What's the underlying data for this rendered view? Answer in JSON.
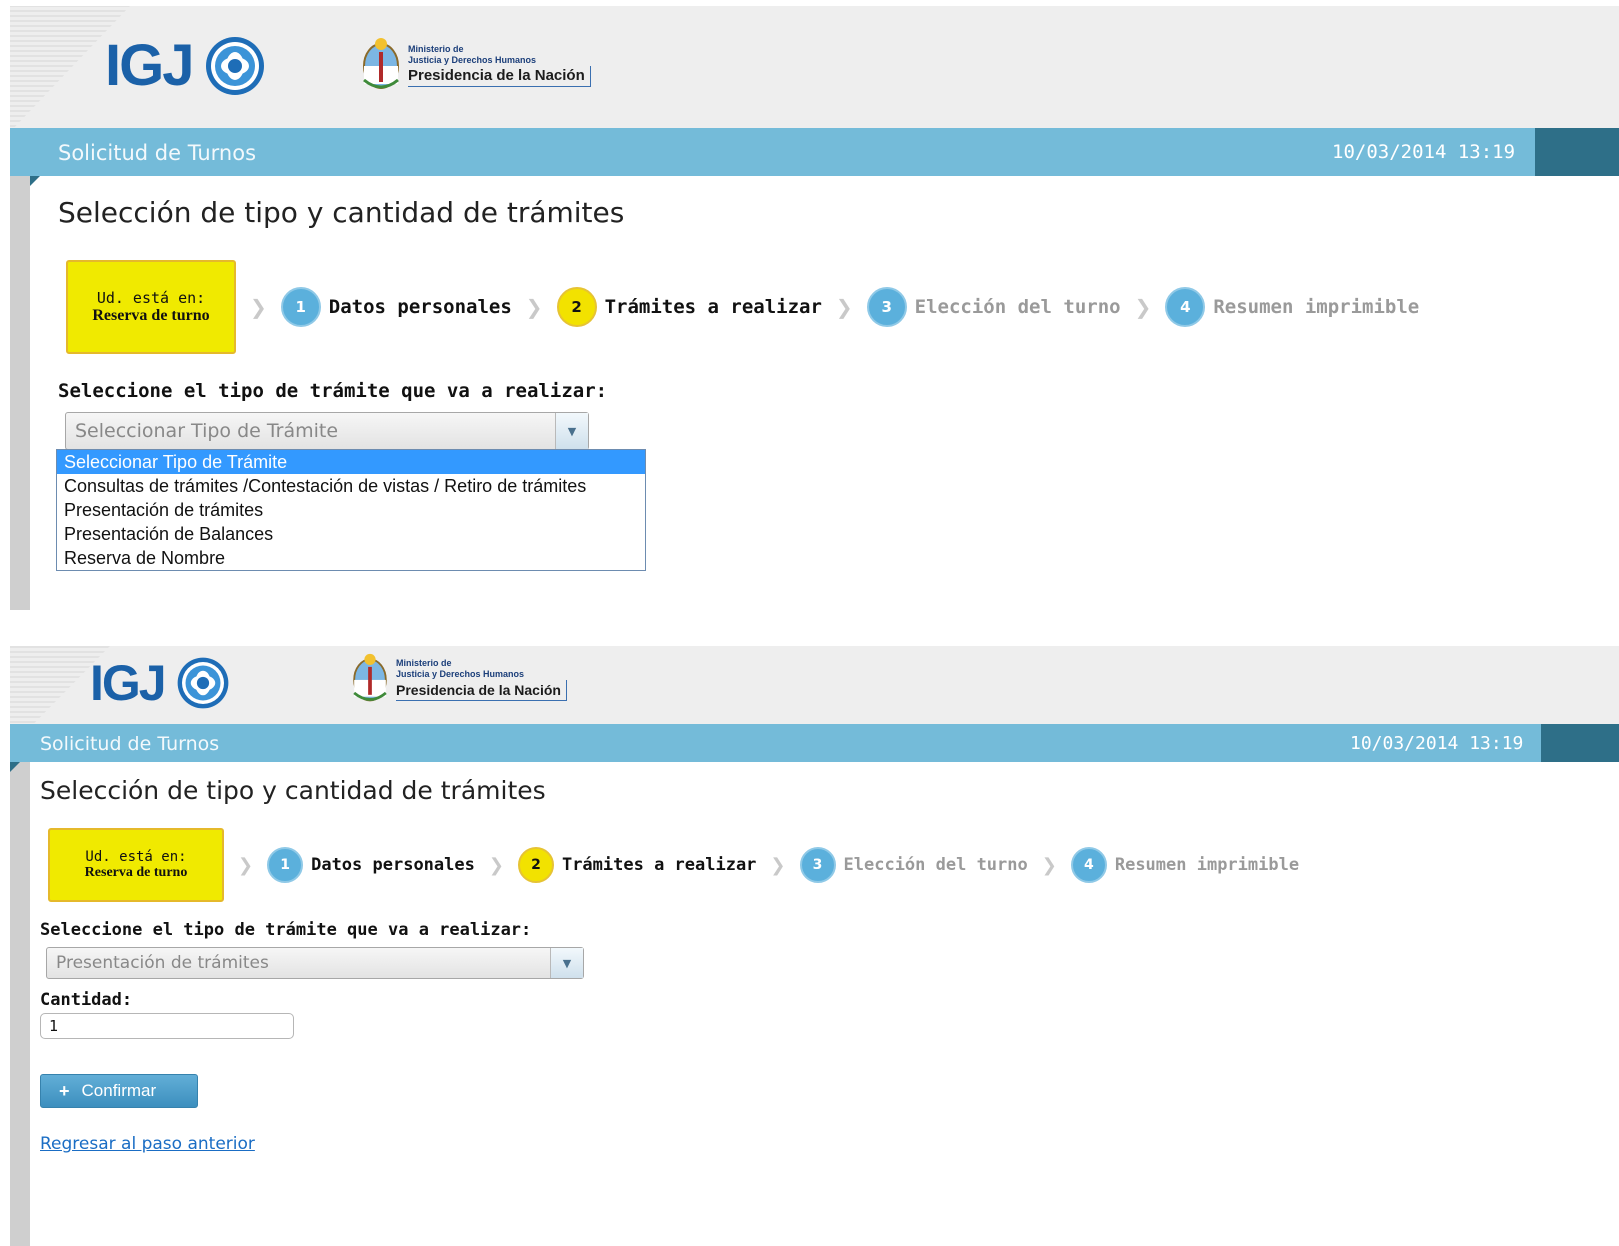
{
  "brand": {
    "logo_text": "IGJ",
    "ministerio_line1": "Ministerio de",
    "ministerio_line2": "Justicia y Derechos Humanos",
    "ministerio_line3": "Presidencia de la Nación"
  },
  "header": {
    "app_title": "Solicitud de Turnos",
    "datetime": "10/03/2014 13:19"
  },
  "page": {
    "title": "Selección de tipo y cantidad de trámites"
  },
  "steps": {
    "you_are_here_line1": "Ud. está en:",
    "you_are_here_line2": "Reserva de turno",
    "items": [
      {
        "number": "1",
        "label": "Datos personales",
        "state": "done"
      },
      {
        "number": "2",
        "label": "Trámites a realizar",
        "state": "active"
      },
      {
        "number": "3",
        "label": "Elección del turno",
        "state": "pending"
      },
      {
        "number": "4",
        "label": "Resumen imprimible",
        "state": "pending"
      }
    ]
  },
  "form": {
    "select_label": "Seleccione el tipo de trámite que va a realizar:",
    "select_placeholder": "Seleccionar Tipo de Trámite",
    "options": [
      "Seleccionar Tipo de Trámite",
      "Consultas de trámites /Contestación de vistas / Retiro de trámites",
      "Presentación de trámites",
      "Presentación de Balances",
      "Reserva de Nombre"
    ],
    "selected_value": "Presentación de trámites",
    "quantity_label": "Cantidad:",
    "quantity_value": "1",
    "confirm_label": "Confirmar",
    "back_link": "Regresar al paso anterior"
  },
  "colors": {
    "titlebar": "#74bbd9",
    "accent_dark": "#2e6f88",
    "step_active": "#f2e200",
    "step_blue": "#5bb0dc",
    "option_highlight": "#3399ff"
  },
  "icons": [
    "igj-logo-icon",
    "argentina-coat-of-arms-icon",
    "chevron-right-icon",
    "dropdown-arrow-icon",
    "plus-icon"
  ]
}
